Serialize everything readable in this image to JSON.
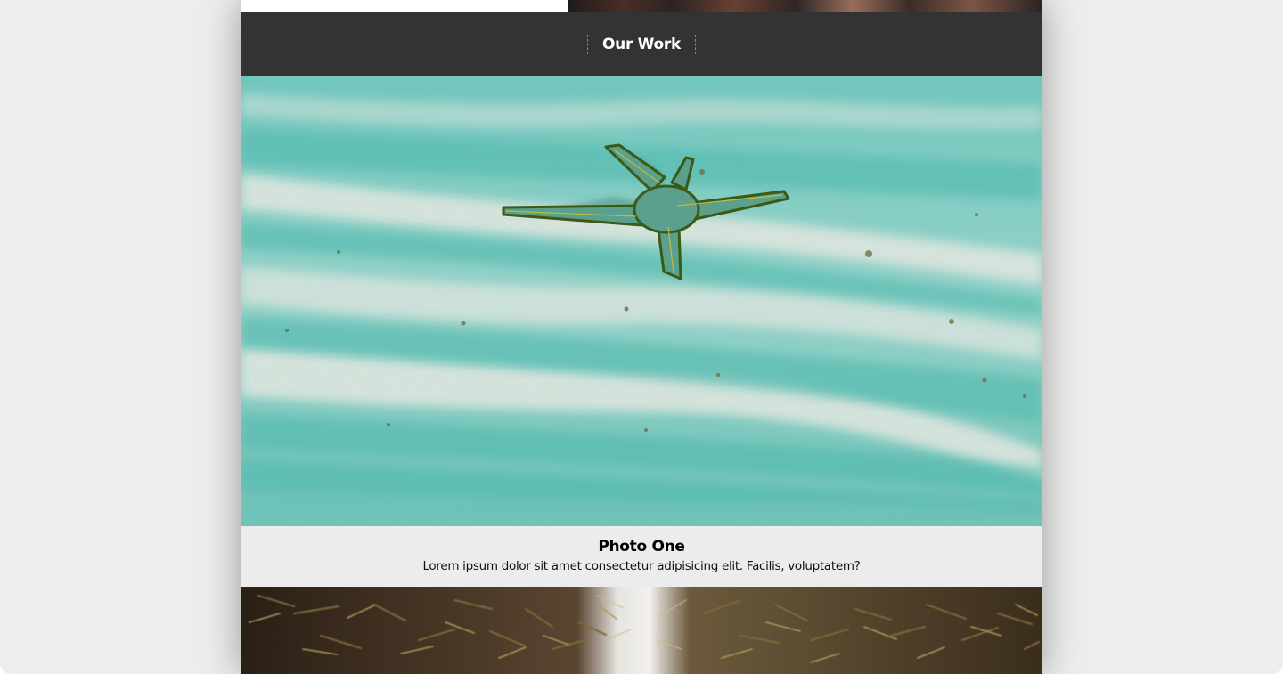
{
  "section": {
    "title": "Our Work"
  },
  "photos": [
    {
      "image": "starfish-on-turquoise-sand-photo",
      "title": "Photo One",
      "description": "Lorem ipsum dolor sit amet consectetur adipisicing elit. Facilis, voluptatem?"
    },
    {
      "image": "bamboo-foliage-photo"
    }
  ],
  "colors": {
    "header_bg": "#333333",
    "caption_bg": "#ececec",
    "outer_bg": "#ededed",
    "page_bg": "#ffffff"
  }
}
